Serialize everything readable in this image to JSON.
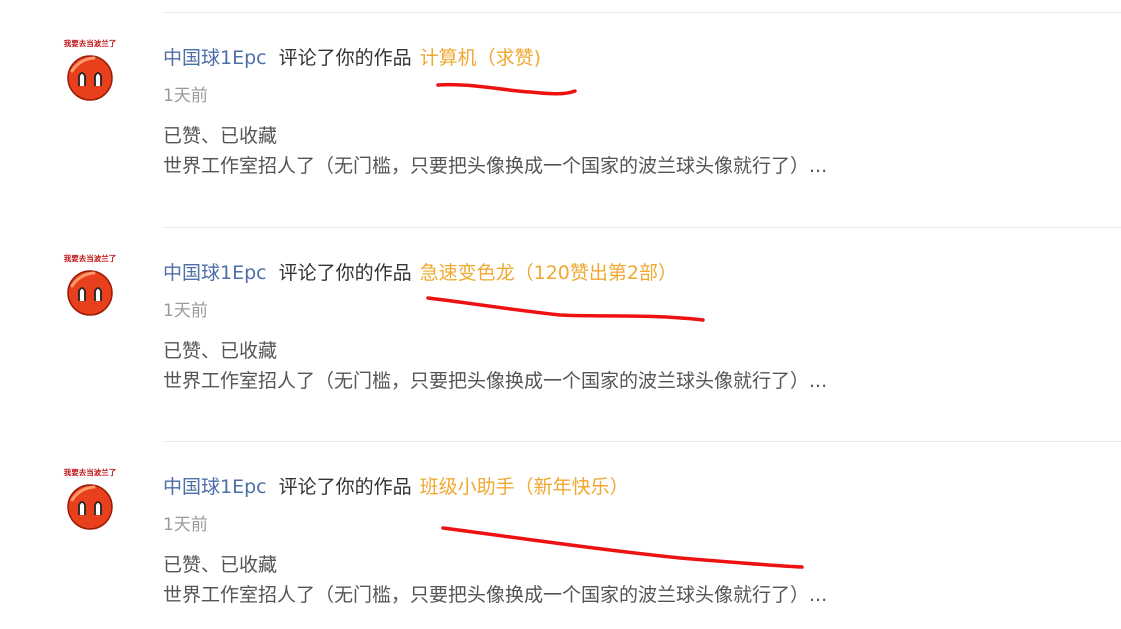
{
  "notifications": [
    {
      "user": "中国球1Epc",
      "action": "评论了你的作品",
      "work": "计算机（求赞)",
      "time": "1天前",
      "reply": "已赞、已收藏",
      "comment": "世界工作室招人了（无门槛，只要把头像换成一个国家的波兰球头像就行了）..."
    },
    {
      "user": "中国球1Epc",
      "action": "评论了你的作品",
      "work": "急速变色龙（120赞出第2部）",
      "time": "1天前",
      "reply": "已赞、已收藏",
      "comment": "世界工作室招人了（无门槛，只要把头像换成一个国家的波兰球头像就行了）..."
    },
    {
      "user": "中国球1Epc",
      "action": "评论了你的作品",
      "work": "班级小助手（新年快乐）",
      "time": "1天前",
      "reply": "已赞、已收藏",
      "comment": "世界工作室招人了（无门槛，只要把头像换成一个国家的波兰球头像就行了）..."
    }
  ],
  "avatar": {
    "banner_text": "我要去当波兰了",
    "ball_color": "#e8401c",
    "icon": "countryball-avatar-icon"
  },
  "colors": {
    "username": "#4d6fa9",
    "work_title": "#f0a830",
    "annotation": "#ee1111"
  }
}
